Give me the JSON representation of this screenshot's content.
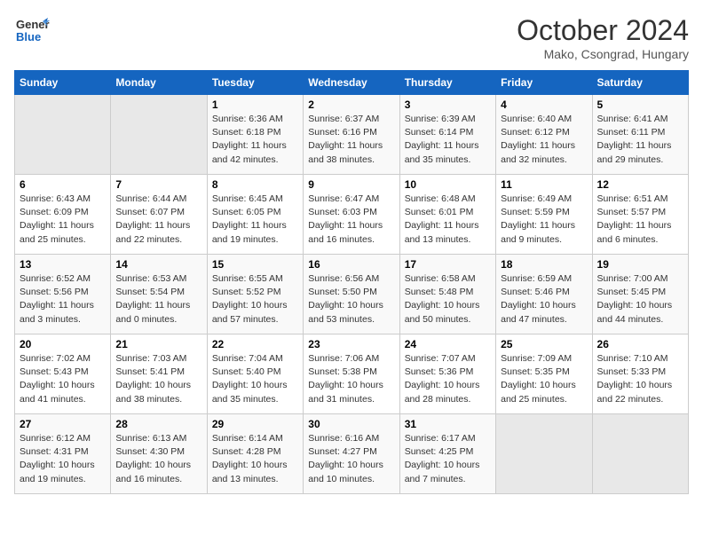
{
  "logo": {
    "general": "General",
    "blue": "Blue"
  },
  "title": "October 2024",
  "location": "Mako, Csongrad, Hungary",
  "days_of_week": [
    "Sunday",
    "Monday",
    "Tuesday",
    "Wednesday",
    "Thursday",
    "Friday",
    "Saturday"
  ],
  "weeks": [
    [
      {
        "day": "",
        "sunrise": "",
        "sunset": "",
        "daylight": "",
        "empty": true
      },
      {
        "day": "",
        "sunrise": "",
        "sunset": "",
        "daylight": "",
        "empty": true
      },
      {
        "day": "1",
        "sunrise": "Sunrise: 6:36 AM",
        "sunset": "Sunset: 6:18 PM",
        "daylight": "Daylight: 11 hours and 42 minutes."
      },
      {
        "day": "2",
        "sunrise": "Sunrise: 6:37 AM",
        "sunset": "Sunset: 6:16 PM",
        "daylight": "Daylight: 11 hours and 38 minutes."
      },
      {
        "day": "3",
        "sunrise": "Sunrise: 6:39 AM",
        "sunset": "Sunset: 6:14 PM",
        "daylight": "Daylight: 11 hours and 35 minutes."
      },
      {
        "day": "4",
        "sunrise": "Sunrise: 6:40 AM",
        "sunset": "Sunset: 6:12 PM",
        "daylight": "Daylight: 11 hours and 32 minutes."
      },
      {
        "day": "5",
        "sunrise": "Sunrise: 6:41 AM",
        "sunset": "Sunset: 6:11 PM",
        "daylight": "Daylight: 11 hours and 29 minutes."
      }
    ],
    [
      {
        "day": "6",
        "sunrise": "Sunrise: 6:43 AM",
        "sunset": "Sunset: 6:09 PM",
        "daylight": "Daylight: 11 hours and 25 minutes."
      },
      {
        "day": "7",
        "sunrise": "Sunrise: 6:44 AM",
        "sunset": "Sunset: 6:07 PM",
        "daylight": "Daylight: 11 hours and 22 minutes."
      },
      {
        "day": "8",
        "sunrise": "Sunrise: 6:45 AM",
        "sunset": "Sunset: 6:05 PM",
        "daylight": "Daylight: 11 hours and 19 minutes."
      },
      {
        "day": "9",
        "sunrise": "Sunrise: 6:47 AM",
        "sunset": "Sunset: 6:03 PM",
        "daylight": "Daylight: 11 hours and 16 minutes."
      },
      {
        "day": "10",
        "sunrise": "Sunrise: 6:48 AM",
        "sunset": "Sunset: 6:01 PM",
        "daylight": "Daylight: 11 hours and 13 minutes."
      },
      {
        "day": "11",
        "sunrise": "Sunrise: 6:49 AM",
        "sunset": "Sunset: 5:59 PM",
        "daylight": "Daylight: 11 hours and 9 minutes."
      },
      {
        "day": "12",
        "sunrise": "Sunrise: 6:51 AM",
        "sunset": "Sunset: 5:57 PM",
        "daylight": "Daylight: 11 hours and 6 minutes."
      }
    ],
    [
      {
        "day": "13",
        "sunrise": "Sunrise: 6:52 AM",
        "sunset": "Sunset: 5:56 PM",
        "daylight": "Daylight: 11 hours and 3 minutes."
      },
      {
        "day": "14",
        "sunrise": "Sunrise: 6:53 AM",
        "sunset": "Sunset: 5:54 PM",
        "daylight": "Daylight: 11 hours and 0 minutes."
      },
      {
        "day": "15",
        "sunrise": "Sunrise: 6:55 AM",
        "sunset": "Sunset: 5:52 PM",
        "daylight": "Daylight: 10 hours and 57 minutes."
      },
      {
        "day": "16",
        "sunrise": "Sunrise: 6:56 AM",
        "sunset": "Sunset: 5:50 PM",
        "daylight": "Daylight: 10 hours and 53 minutes."
      },
      {
        "day": "17",
        "sunrise": "Sunrise: 6:58 AM",
        "sunset": "Sunset: 5:48 PM",
        "daylight": "Daylight: 10 hours and 50 minutes."
      },
      {
        "day": "18",
        "sunrise": "Sunrise: 6:59 AM",
        "sunset": "Sunset: 5:46 PM",
        "daylight": "Daylight: 10 hours and 47 minutes."
      },
      {
        "day": "19",
        "sunrise": "Sunrise: 7:00 AM",
        "sunset": "Sunset: 5:45 PM",
        "daylight": "Daylight: 10 hours and 44 minutes."
      }
    ],
    [
      {
        "day": "20",
        "sunrise": "Sunrise: 7:02 AM",
        "sunset": "Sunset: 5:43 PM",
        "daylight": "Daylight: 10 hours and 41 minutes."
      },
      {
        "day": "21",
        "sunrise": "Sunrise: 7:03 AM",
        "sunset": "Sunset: 5:41 PM",
        "daylight": "Daylight: 10 hours and 38 minutes."
      },
      {
        "day": "22",
        "sunrise": "Sunrise: 7:04 AM",
        "sunset": "Sunset: 5:40 PM",
        "daylight": "Daylight: 10 hours and 35 minutes."
      },
      {
        "day": "23",
        "sunrise": "Sunrise: 7:06 AM",
        "sunset": "Sunset: 5:38 PM",
        "daylight": "Daylight: 10 hours and 31 minutes."
      },
      {
        "day": "24",
        "sunrise": "Sunrise: 7:07 AM",
        "sunset": "Sunset: 5:36 PM",
        "daylight": "Daylight: 10 hours and 28 minutes."
      },
      {
        "day": "25",
        "sunrise": "Sunrise: 7:09 AM",
        "sunset": "Sunset: 5:35 PM",
        "daylight": "Daylight: 10 hours and 25 minutes."
      },
      {
        "day": "26",
        "sunrise": "Sunrise: 7:10 AM",
        "sunset": "Sunset: 5:33 PM",
        "daylight": "Daylight: 10 hours and 22 minutes."
      }
    ],
    [
      {
        "day": "27",
        "sunrise": "Sunrise: 6:12 AM",
        "sunset": "Sunset: 4:31 PM",
        "daylight": "Daylight: 10 hours and 19 minutes."
      },
      {
        "day": "28",
        "sunrise": "Sunrise: 6:13 AM",
        "sunset": "Sunset: 4:30 PM",
        "daylight": "Daylight: 10 hours and 16 minutes."
      },
      {
        "day": "29",
        "sunrise": "Sunrise: 6:14 AM",
        "sunset": "Sunset: 4:28 PM",
        "daylight": "Daylight: 10 hours and 13 minutes."
      },
      {
        "day": "30",
        "sunrise": "Sunrise: 6:16 AM",
        "sunset": "Sunset: 4:27 PM",
        "daylight": "Daylight: 10 hours and 10 minutes."
      },
      {
        "day": "31",
        "sunrise": "Sunrise: 6:17 AM",
        "sunset": "Sunset: 4:25 PM",
        "daylight": "Daylight: 10 hours and 7 minutes."
      },
      {
        "day": "",
        "sunrise": "",
        "sunset": "",
        "daylight": "",
        "empty": true
      },
      {
        "day": "",
        "sunrise": "",
        "sunset": "",
        "daylight": "",
        "empty": true
      }
    ]
  ]
}
